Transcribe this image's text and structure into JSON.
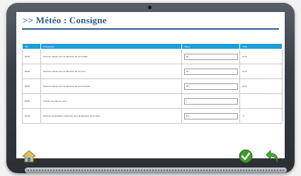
{
  "page": {
    "title": ">> Météo : Consigne"
  },
  "table": {
    "headers": [
      "Réf",
      "Désignation",
      "Valeur",
      "Unité"
    ],
    "rows": [
      {
        "ref": "EA01",
        "designation": "Seuil de vitesse pour la détection de vent faible",
        "value": "20",
        "unit": "km/h"
      },
      {
        "ref": "EA02",
        "designation": "Seuil de vitesse pour la détection de vent fort",
        "value": "50",
        "unit": "km/h"
      },
      {
        "ref": "EA03",
        "designation": "Seuil de vitesse pour la détection de vent tempête",
        "value": "80",
        "unit": "km/h"
      },
      {
        "ref": "EA04",
        "designation": "Fenêtre de prise de vent",
        "value": "1",
        "unit": ""
      },
      {
        "ref": "EA05",
        "designation": "Seuil de température extérieure pour la détection de la neige",
        "value": "0.5",
        "unit": "°C"
      }
    ]
  },
  "icons": {
    "home": "home-icon",
    "ok": "check-icon",
    "back": "back-arrow-icon"
  },
  "colors": {
    "accent": "#1e9ed8",
    "title": "#2f5c86",
    "ok": "#3c9a2a",
    "back": "#4aa832"
  }
}
